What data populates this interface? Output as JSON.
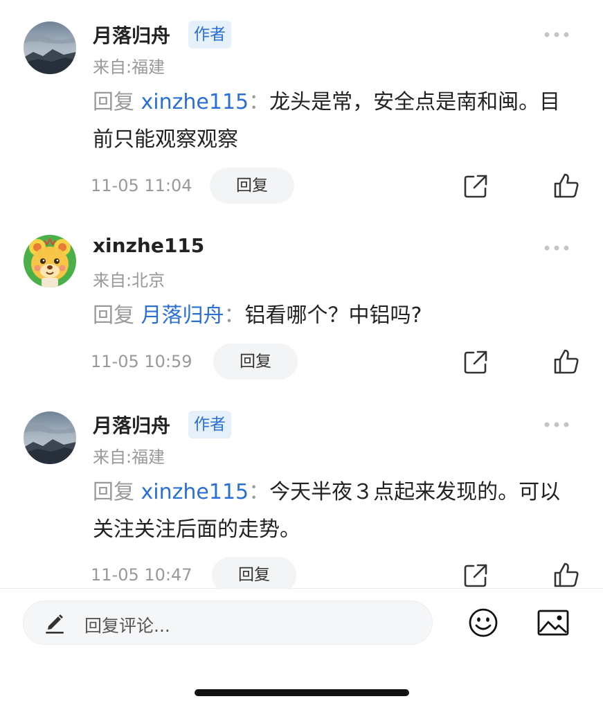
{
  "comments": [
    {
      "username": "月落归舟",
      "badge": "作者",
      "location": "来自:福建",
      "reply_prefix": "回复",
      "reply_target": "xinzhe115",
      "separator": "：",
      "text": "龙头是常，安全点是南和闽。目前只能观察观察",
      "timestamp": "11-05 11:04",
      "reply_label": "回复"
    },
    {
      "username": "xinzhe115",
      "location": "来自:北京",
      "reply_prefix": "回复",
      "reply_target": "月落归舟",
      "separator": "：",
      "text": "铝看哪个？中铝吗?",
      "timestamp": "11-05 10:59",
      "reply_label": "回复"
    },
    {
      "username": "月落归舟",
      "badge": "作者",
      "location": "来自:福建",
      "reply_prefix": "回复",
      "reply_target": "xinzhe115",
      "separator": "：",
      "text": "今天半夜３点起来发现的。可以关注关注后面的走势。",
      "timestamp": "11-05 10:47",
      "reply_label": "回复"
    }
  ],
  "bottom_bar": {
    "placeholder": "回复评论..."
  },
  "icons": {
    "more": "more-dots-icon",
    "share": "share-icon",
    "like": "thumbs-up-icon",
    "pencil": "pencil-icon",
    "emoji": "emoji-icon",
    "image": "image-icon"
  },
  "colors": {
    "link": "#2a6fd6",
    "badge_bg": "#e6f0fb",
    "muted": "#999999",
    "pill_bg": "#f2f4f5"
  }
}
